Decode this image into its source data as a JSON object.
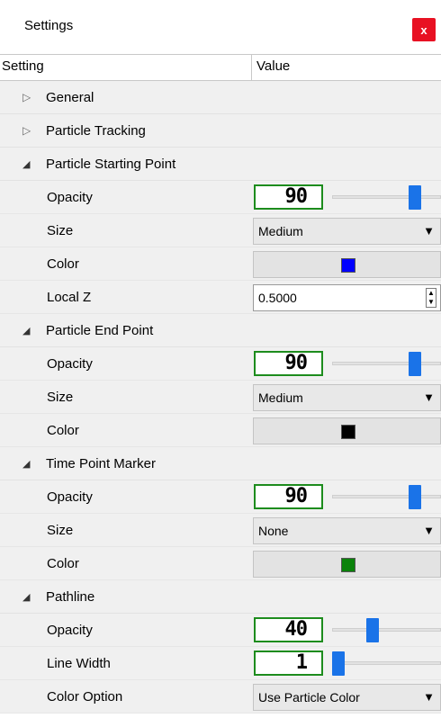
{
  "window": {
    "title": "Settings",
    "close_label": "x"
  },
  "columns": {
    "setting": "Setting",
    "value": "Value"
  },
  "groups": [
    {
      "name": "General",
      "expanded": false,
      "items": []
    },
    {
      "name": "Particle Tracking",
      "expanded": false,
      "items": []
    },
    {
      "name": "Particle Starting Point",
      "expanded": true,
      "items": [
        {
          "label": "Opacity",
          "kind": "slider",
          "value": "90",
          "level": 0.9
        },
        {
          "label": "Size",
          "kind": "select",
          "value": "Medium"
        },
        {
          "label": "Color",
          "kind": "color",
          "color": "#0000ff"
        },
        {
          "label": "Local Z",
          "kind": "spin",
          "value": "0.5000"
        }
      ]
    },
    {
      "name": "Particle End Point",
      "expanded": true,
      "items": [
        {
          "label": "Opacity",
          "kind": "slider",
          "value": "90",
          "level": 0.9
        },
        {
          "label": "Size",
          "kind": "select",
          "value": "Medium"
        },
        {
          "label": "Color",
          "kind": "color",
          "color": "#000000"
        }
      ]
    },
    {
      "name": "Time Point Marker",
      "expanded": true,
      "items": [
        {
          "label": "Opacity",
          "kind": "slider",
          "value": "90",
          "level": 0.9
        },
        {
          "label": "Size",
          "kind": "select",
          "value": "None"
        },
        {
          "label": "Color",
          "kind": "color",
          "color": "#0a820a"
        }
      ]
    },
    {
      "name": "Pathline",
      "expanded": true,
      "items": [
        {
          "label": "Opacity",
          "kind": "slider",
          "value": "40",
          "level": 0.4
        },
        {
          "label": "Line Width",
          "kind": "slider",
          "value": "1",
          "level": 0.0
        },
        {
          "label": "Color Option",
          "kind": "select",
          "value": "Use Particle Color"
        }
      ]
    }
  ]
}
